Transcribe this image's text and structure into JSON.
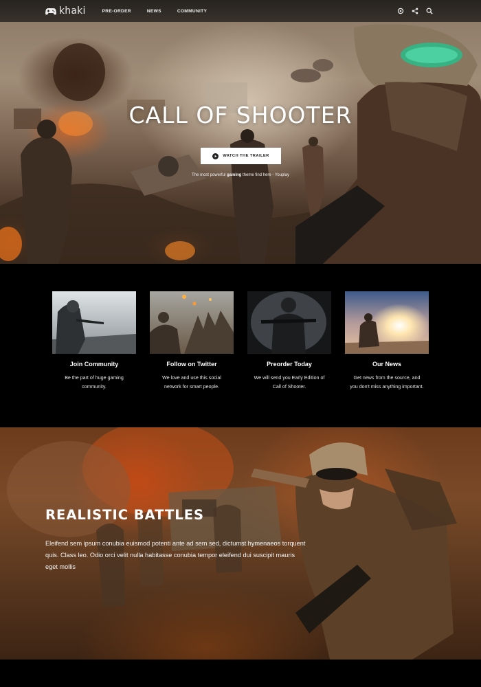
{
  "navbar": {
    "logo_text": "khaki",
    "links": [
      "PRE-ORDER",
      "NEWS",
      "COMMUNITY"
    ],
    "icons": [
      "settings-icon",
      "share-icon",
      "search-icon"
    ]
  },
  "hero": {
    "title": "CALL OF SHOOTER",
    "button_label": "WATCH THE TRAILER",
    "tagline_prefix": "The most powerful ",
    "tagline_bold": "gaming",
    "tagline_suffix": " theme find here - Youplay"
  },
  "features": [
    {
      "title": "Join Community",
      "text": "Be the part of huge gaming community."
    },
    {
      "title": "Follow on Twitter",
      "text": "We love and use this social network for smart people."
    },
    {
      "title": "Preorder Today",
      "text": "We will send you Early Edition of Call of Shooter."
    },
    {
      "title": "Our News",
      "text": "Get news from the source, and you don't miss anything important."
    }
  ],
  "battles": {
    "title": "REALISTIC BATTLES",
    "text": "Eleifend sem ipsum conubia euismod potenti ante ad sem sed, dictumst hymenaeos torquent quis. Class leo. Odio orci velit nulla habitasse conubia tempor eleifend dui suscipit mauris eget mollis"
  },
  "colors": {
    "navbar_bg": "#2a2723",
    "button_bg": "#ffffff",
    "section_bg": "#000000"
  }
}
